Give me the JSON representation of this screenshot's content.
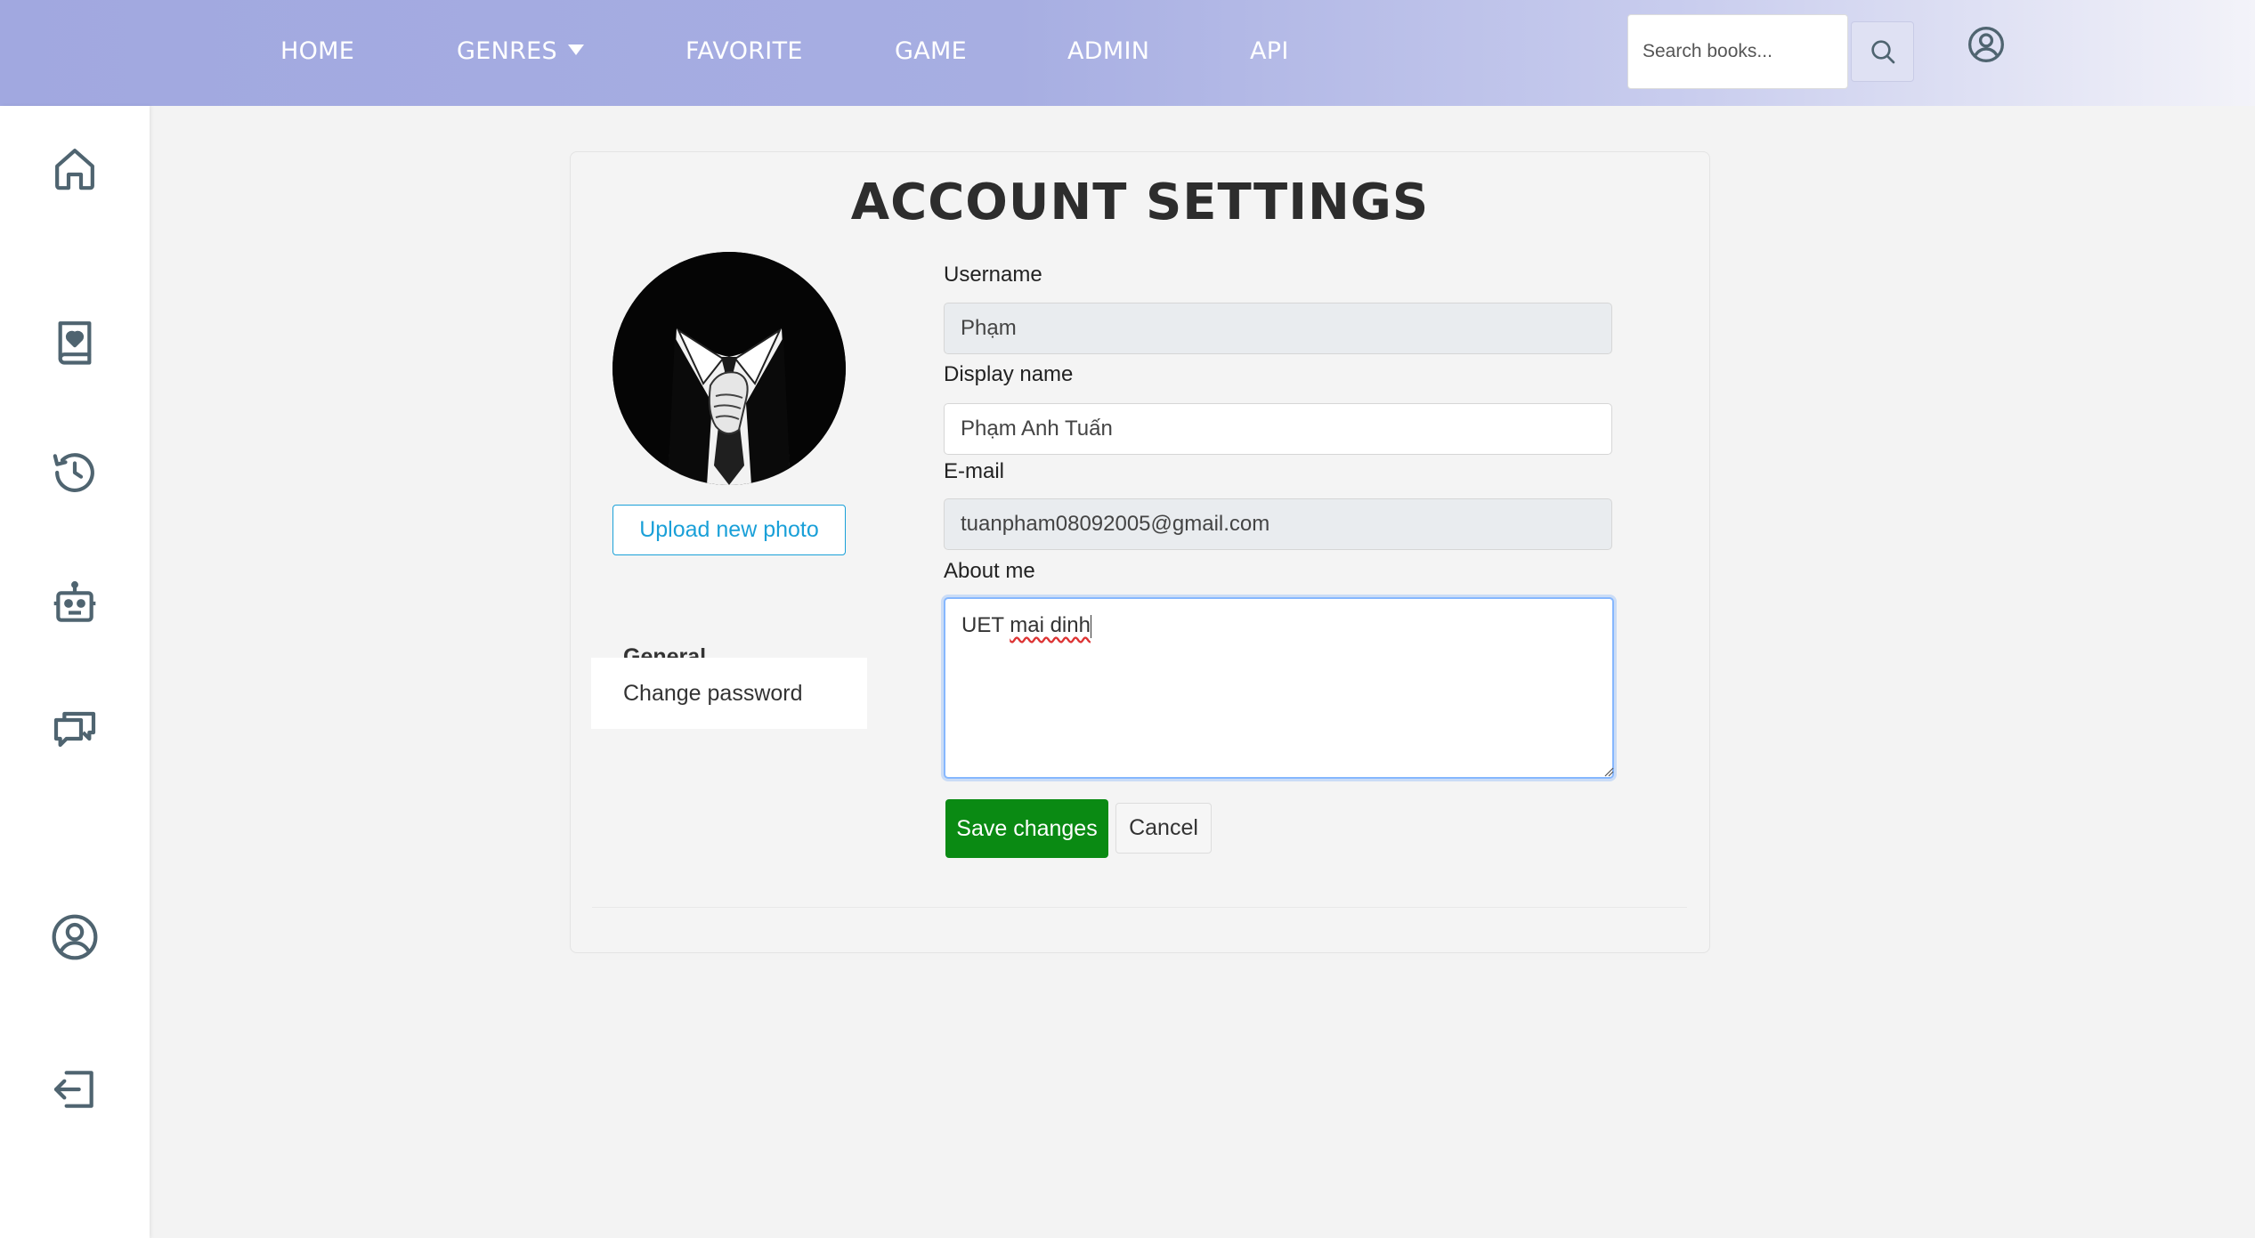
{
  "nav": {
    "home": "HOME",
    "genres": "GENRES",
    "favorite": "FAVORITE",
    "game": "GAME",
    "admin": "ADMIN",
    "api": "API"
  },
  "search": {
    "placeholder": "Search books...",
    "icon": "search-icon"
  },
  "header_user_icon": "user-circle-icon",
  "sidebar": {
    "icons": [
      "home-icon",
      "book-heart-icon",
      "history-icon",
      "robot-icon",
      "chat-icon",
      "user-circle-icon",
      "logout-icon"
    ]
  },
  "settings": {
    "title": "ACCOUNT SETTINGS",
    "upload_label": "Upload new photo",
    "menu": {
      "general": "General",
      "change_password": "Change password"
    },
    "fields": {
      "username_label": "Username",
      "username_value": "Phạm",
      "display_label": "Display name",
      "display_value": "Phạm Anh Tuấn",
      "email_label": "E-mail",
      "email_value": "tuanpham08092005@gmail.com",
      "about_label": "About me",
      "about_prefix": "UET ",
      "about_spellchecked": "mai dinh"
    },
    "save_label": "Save changes",
    "cancel_label": "Cancel"
  },
  "colors": {
    "nav_gradient_start": "#a1a8e0",
    "primary_green": "#0a8a13",
    "upload_blue": "#1aa0d8",
    "icon_gray": "#4f6470"
  }
}
